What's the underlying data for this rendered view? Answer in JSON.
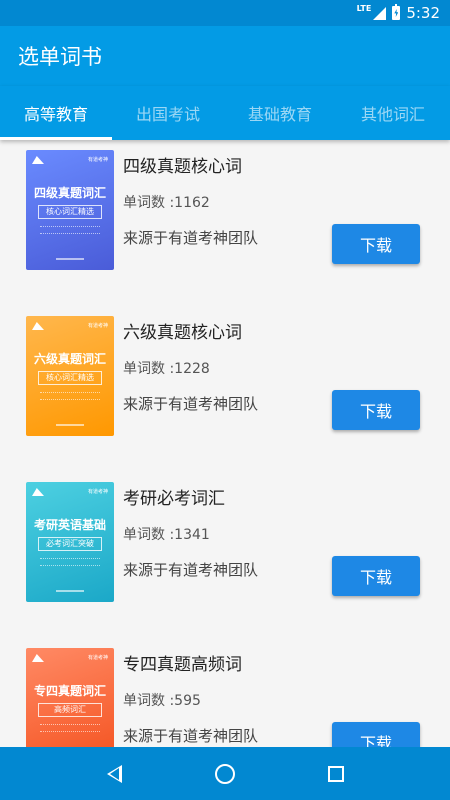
{
  "status_bar": {
    "network": "LTE",
    "time": "5:32"
  },
  "app_bar": {
    "title": "选单词书"
  },
  "tabs": [
    {
      "label": "高等教育",
      "active": true
    },
    {
      "label": "出国考试",
      "active": false
    },
    {
      "label": "基础教育",
      "active": false
    },
    {
      "label": "其他词汇",
      "active": false
    }
  ],
  "books": [
    {
      "name": "四级真题核心词",
      "count_label": "单词数 :1162",
      "source": "来源于有道考神团队",
      "download_label": "下载",
      "cover_title": "四级真题词汇",
      "cover_sub": "核心词汇精选",
      "cover_brand": "有道考神",
      "cover_color": "#5b7cf4"
    },
    {
      "name": "六级真题核心词",
      "count_label": "单词数 :1228",
      "source": "来源于有道考神团队",
      "download_label": "下载",
      "cover_title": "六级真题词汇",
      "cover_sub": "核心词汇精选",
      "cover_brand": "有道考神",
      "cover_color": "#ffa726"
    },
    {
      "name": "考研必考词汇",
      "count_label": "单词数 :1341",
      "source": "来源于有道考神团队",
      "download_label": "下载",
      "cover_title": "考研英语基础",
      "cover_sub": "必考词汇突破",
      "cover_brand": "有道考神",
      "cover_color": "#26c6da"
    },
    {
      "name": "专四真题高频词",
      "count_label": "单词数 :595",
      "source": "来源于有道考神团队",
      "download_label": "下载",
      "cover_title": "专四真题词汇",
      "cover_sub": "高频词汇",
      "cover_brand": "有道考神",
      "cover_color": "#ff6e40"
    }
  ],
  "colors": {
    "status_bar": "#0288d1",
    "app_bar": "#039be5",
    "button": "#1e88e5"
  },
  "nav": {
    "icons": [
      "back-icon",
      "home-icon",
      "recent-apps-icon"
    ]
  }
}
